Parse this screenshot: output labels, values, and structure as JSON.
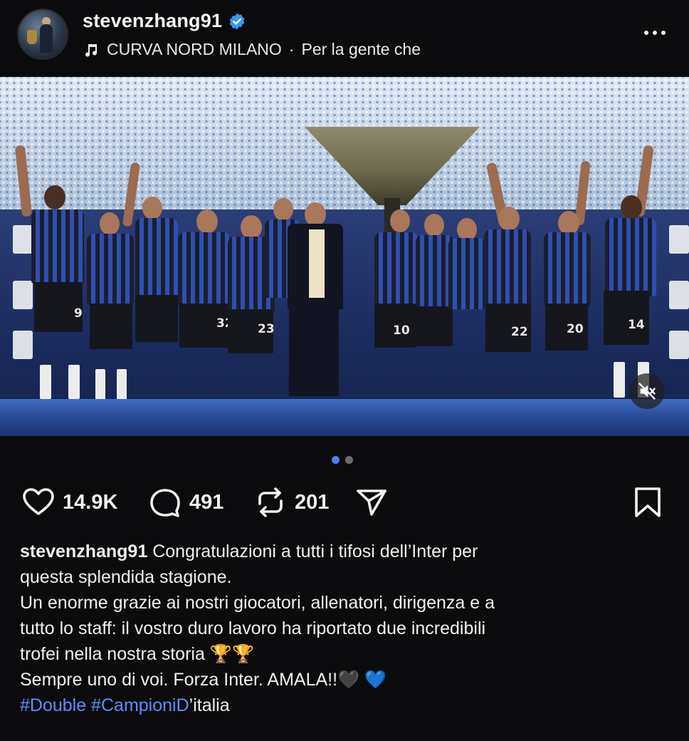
{
  "header": {
    "username": "stevenzhang91",
    "music": {
      "artist": "CURVA NORD MILANO",
      "separator": "·",
      "track": "Per la gente che"
    }
  },
  "carousel": {
    "current": 1,
    "total": 2
  },
  "photo": {
    "jersey_numbers": [
      "9",
      "32",
      "23",
      "10",
      "22",
      "20",
      "14"
    ]
  },
  "actions": {
    "likes": "14.9K",
    "comments": "491",
    "reposts": "201"
  },
  "caption": {
    "username": "stevenzhang91",
    "line1": "Congratulazioni a tutti i tifosi dell’Inter per",
    "line2": "questa splendida stagione.",
    "line3": "Un enorme grazie ai nostri giocatori, allenatori, dirigenza e a",
    "line4": "tutto lo staff: il vostro duro lavoro ha riportato due incredibili",
    "line5": "trofei nella nostra storia",
    "line5_emoji": "🏆🏆",
    "line6": "Sempre uno di voi. Forza Inter. AMALA!!",
    "line6_emoji": "🖤 💙",
    "hashtag1": "#Double",
    "hashtag2": "#CampioniD",
    "hashtag2_suffix": "’italia"
  },
  "colors": {
    "background": "#0b0b0d",
    "verified_badge": "#3897f0",
    "hashtag": "#5b8ff7",
    "active_dot": "#4f7df2"
  },
  "icons": [
    "verified-badge-icon",
    "music-note-icon",
    "more-options-icon",
    "mute-icon",
    "heart-icon",
    "comment-icon",
    "repost-icon",
    "share-icon",
    "bookmark-icon"
  ]
}
